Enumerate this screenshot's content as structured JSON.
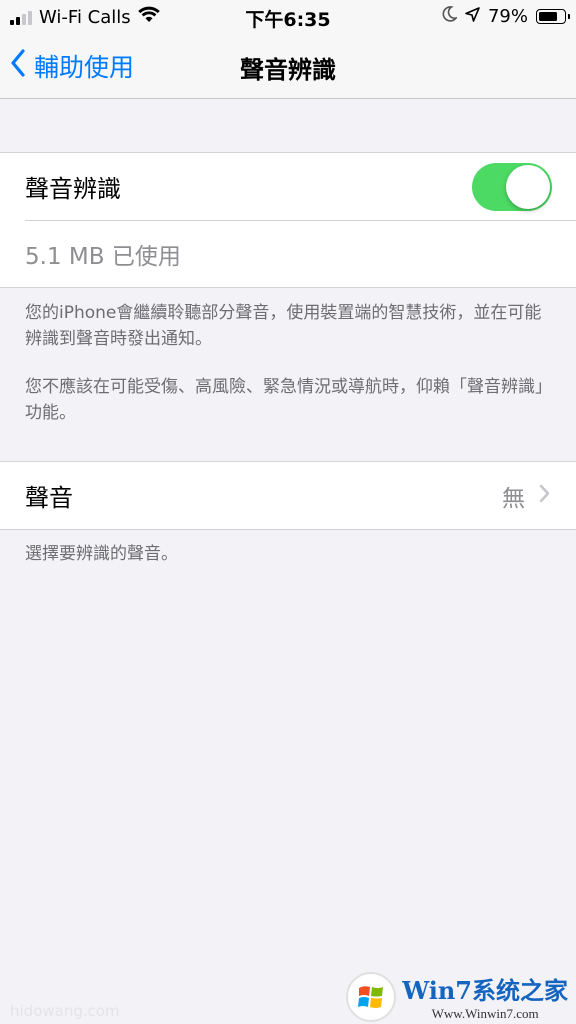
{
  "status_bar": {
    "carrier": "Wi-Fi Calls",
    "time": "下午6:35",
    "battery": "79%",
    "battery_level": 0.79
  },
  "nav": {
    "back_label": "輔助使用",
    "title": "聲音辨識"
  },
  "recognition_group": {
    "toggle_label": "聲音辨識",
    "toggle_on": true,
    "usage": "5.1 MB 已使用"
  },
  "description": {
    "paragraph1": "您的iPhone會繼續聆聽部分聲音，使用裝置端的智慧技術，並在可能辨識到聲音時發出通知。",
    "paragraph2": "您不應該在可能受傷、高風險、緊急情況或導航時，仰賴「聲音辨識」功能。"
  },
  "sounds_group": {
    "label": "聲音",
    "value": "無",
    "footer": "選擇要辨識的聲音。"
  },
  "watermark": {
    "brand": "Win7系统之家",
    "url": "Www.Winwin7.com",
    "left_text": "hidowang.com"
  },
  "colors": {
    "accent": "#007aff",
    "toggle_on": "#4cd964",
    "background": "#f2f2f7"
  }
}
